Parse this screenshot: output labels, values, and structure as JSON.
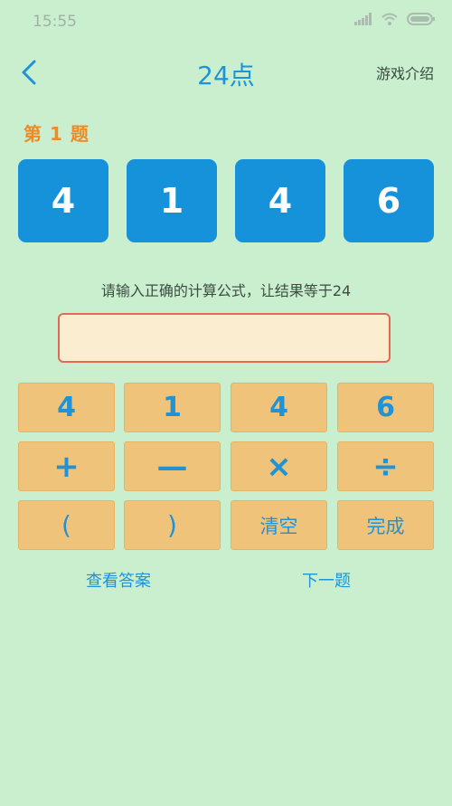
{
  "status": {
    "time": "15:55"
  },
  "nav": {
    "title": "24点",
    "intro_label": "游戏介绍"
  },
  "question": {
    "label": "第 1 题"
  },
  "cards": [
    "4",
    "1",
    "4",
    "6"
  ],
  "hint": "请输入正确的计算公式，让结果等于24",
  "formula": {
    "value": ""
  },
  "keypad": {
    "row1": [
      "4",
      "1",
      "4",
      "6"
    ],
    "row2": [
      "+",
      "—",
      "×",
      "÷"
    ],
    "row3": [
      "(",
      ")",
      "清空",
      "完成"
    ]
  },
  "actions": {
    "show_answer": "查看答案",
    "next": "下一题"
  },
  "colors": {
    "background": "#c9efcf",
    "accent": "#1f93d6",
    "card": "#1592d9",
    "key": "#f0c37a",
    "label": "#f08a24",
    "input_border": "#e06a55"
  }
}
